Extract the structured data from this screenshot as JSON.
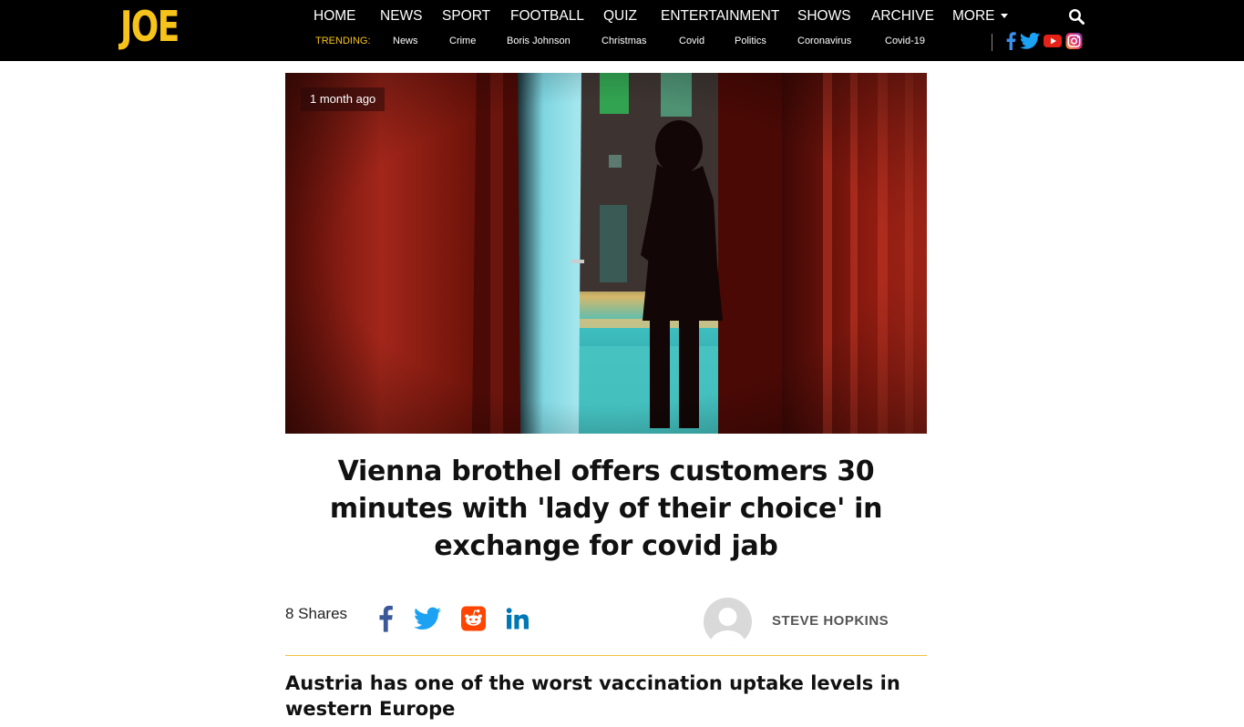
{
  "header": {
    "logo": "JOE",
    "nav": [
      "HOME",
      "NEWS",
      "SPORT",
      "FOOTBALL",
      "QUIZ",
      "ENTERTAINMENT",
      "SHOWS",
      "ARCHIVE",
      "MORE"
    ],
    "trending_label": "TRENDING:",
    "trending": [
      "News",
      "Crime",
      "Boris Johnson",
      "Christmas",
      "Covid",
      "Politics",
      "Coronavirus",
      "Covid-19"
    ],
    "social_icons": [
      "facebook-icon",
      "twitter-icon",
      "youtube-icon",
      "instagram-icon"
    ],
    "colors": {
      "bar": "#000000",
      "accent": "#f6c31a"
    }
  },
  "article": {
    "time_ago": "1 month ago",
    "headline": "Vienna brothel offers customers 30 minutes with 'lady of their choice' in exchange for covid jab",
    "shares": "8 Shares",
    "share_icons": [
      "facebook-icon",
      "twitter-icon",
      "reddit-icon",
      "linkedin-icon"
    ],
    "author": "STEVE HOPKINS",
    "subheading": "Austria has one of the worst vaccination uptake levels in western Europe",
    "colors": {
      "facebook": "#3b5998",
      "twitter": "#1da1f2",
      "reddit": "#ff4500",
      "linkedin": "#0077b5",
      "rule": "#f0c040"
    }
  }
}
